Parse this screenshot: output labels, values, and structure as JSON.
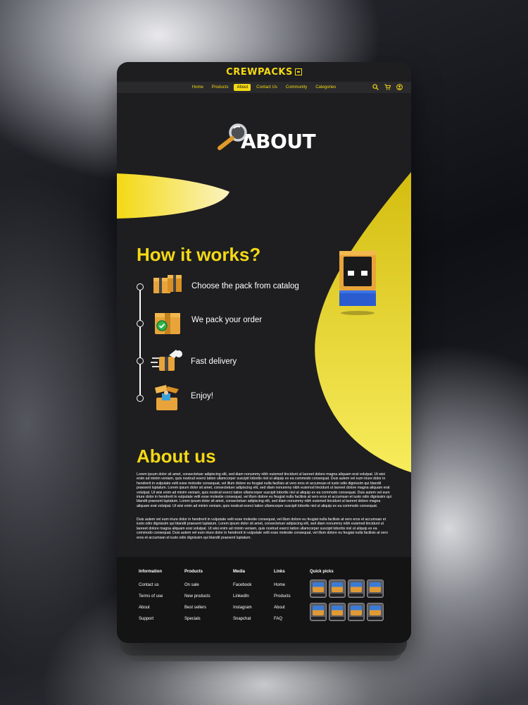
{
  "brand": {
    "name": "CREWPACKS"
  },
  "nav": {
    "items": [
      "Home",
      "Products",
      "About",
      "Contact Us",
      "Community",
      "Categories"
    ],
    "active": "About"
  },
  "hero": {
    "title": "ABOUT"
  },
  "how": {
    "title": "How it works?",
    "steps": [
      "Choose the pack from catalog",
      "We pack your order",
      "Fast delivery",
      "Enjoy!"
    ]
  },
  "about": {
    "title": "About us",
    "p1": "Lorem ipsum dolor sit amet, consectetuer adipiscing elit, sed diam nonummy nibh euismod tincidunt ut laoreet dolore magna aliquam erat volutpat. Ut wisi enim ad minim veniam, quis nostrud exerci tation ullamcorper suscipit lobortis nisl ut aliquip ex ea commodo consequat. Duis autem vel eum iriure dolor in hendrerit in vulputate velit esse molestie consequat, vel illum dolore eu feugiat nulla facilisis at vero eros et accumsan et iusto odio dignissim qui blandit praesent luptatum. Lorem ipsum dolor sit amet, consectetuer adipiscing elit, sed diam nonummy nibh euismod tincidunt ut laoreet dolore magna aliquam erat volutpat. Ut wisi enim ad minim veniam, quis nostrud exerci tation ullamcorper suscipit lobortis nisl ut aliquip ex ea commodo consequat. Duis autem vel eum iriure dolor in hendrerit in vulputate velit esse molestie consequat, vel illum dolore eu feugiat nulla facilisis at vero eros et accumsan et iusto odio dignissim qui blandit praesent luptatum. Lorem ipsum dolor sit amet, consectetuer adipiscing elit, sed diam nonummy nibh euismod tincidunt ut laoreet dolore magna aliquam erat volutpat. Ut wisi enim ad minim veniam, quis nostrud exerci tation ullamcorper suscipit lobortis nisl ut aliquip ex ea commodo consequat.",
    "p2": "Duis autem vel eum iriure dolor in hendrerit in vulputate velit esse molestie consequat, vel illum dolore eu feugiat nulla facilisis at vero eros et accumsan et iusto odio dignissim qui blandit praesent luptatum. Lorem ipsum dolor sit amet, consectetuer adipiscing elit, sed diam nonummy nibh euismod tincidunt ut laoreet dolore magna aliquam erat volutpat. Ut wisi enim ad minim veniam, quis nostrud exerci tation ullamcorper suscipit lobortis nisl ut aliquip ex ea commodo consequat. Duis autem vel eum iriure dolor in hendrerit in vulputate velit esse molestie consequat, vel illum dolore eu feugiat nulla facilisis at vero eros et accumsan et iusto odio dignissim qui blandit praesent luptatum."
  },
  "footer": {
    "info": {
      "title": "Information",
      "links": [
        "Contact us",
        "Terms of use",
        "About",
        "Support"
      ]
    },
    "products": {
      "title": "Products",
      "links": [
        "On sale",
        "New products",
        "Best sellers",
        "Specials"
      ]
    },
    "media": {
      "title": "Media",
      "links": [
        "Facebook",
        "LinkedIn",
        "Instagram",
        "Snapchat"
      ]
    },
    "links": {
      "title": "Links",
      "links": [
        "Home",
        "Products",
        "About",
        "FAQ"
      ]
    },
    "quick": {
      "title": "Quick picks"
    }
  },
  "colors": {
    "accent": "#f4d914",
    "bg": "#1e1e20",
    "footer": "#141414"
  }
}
